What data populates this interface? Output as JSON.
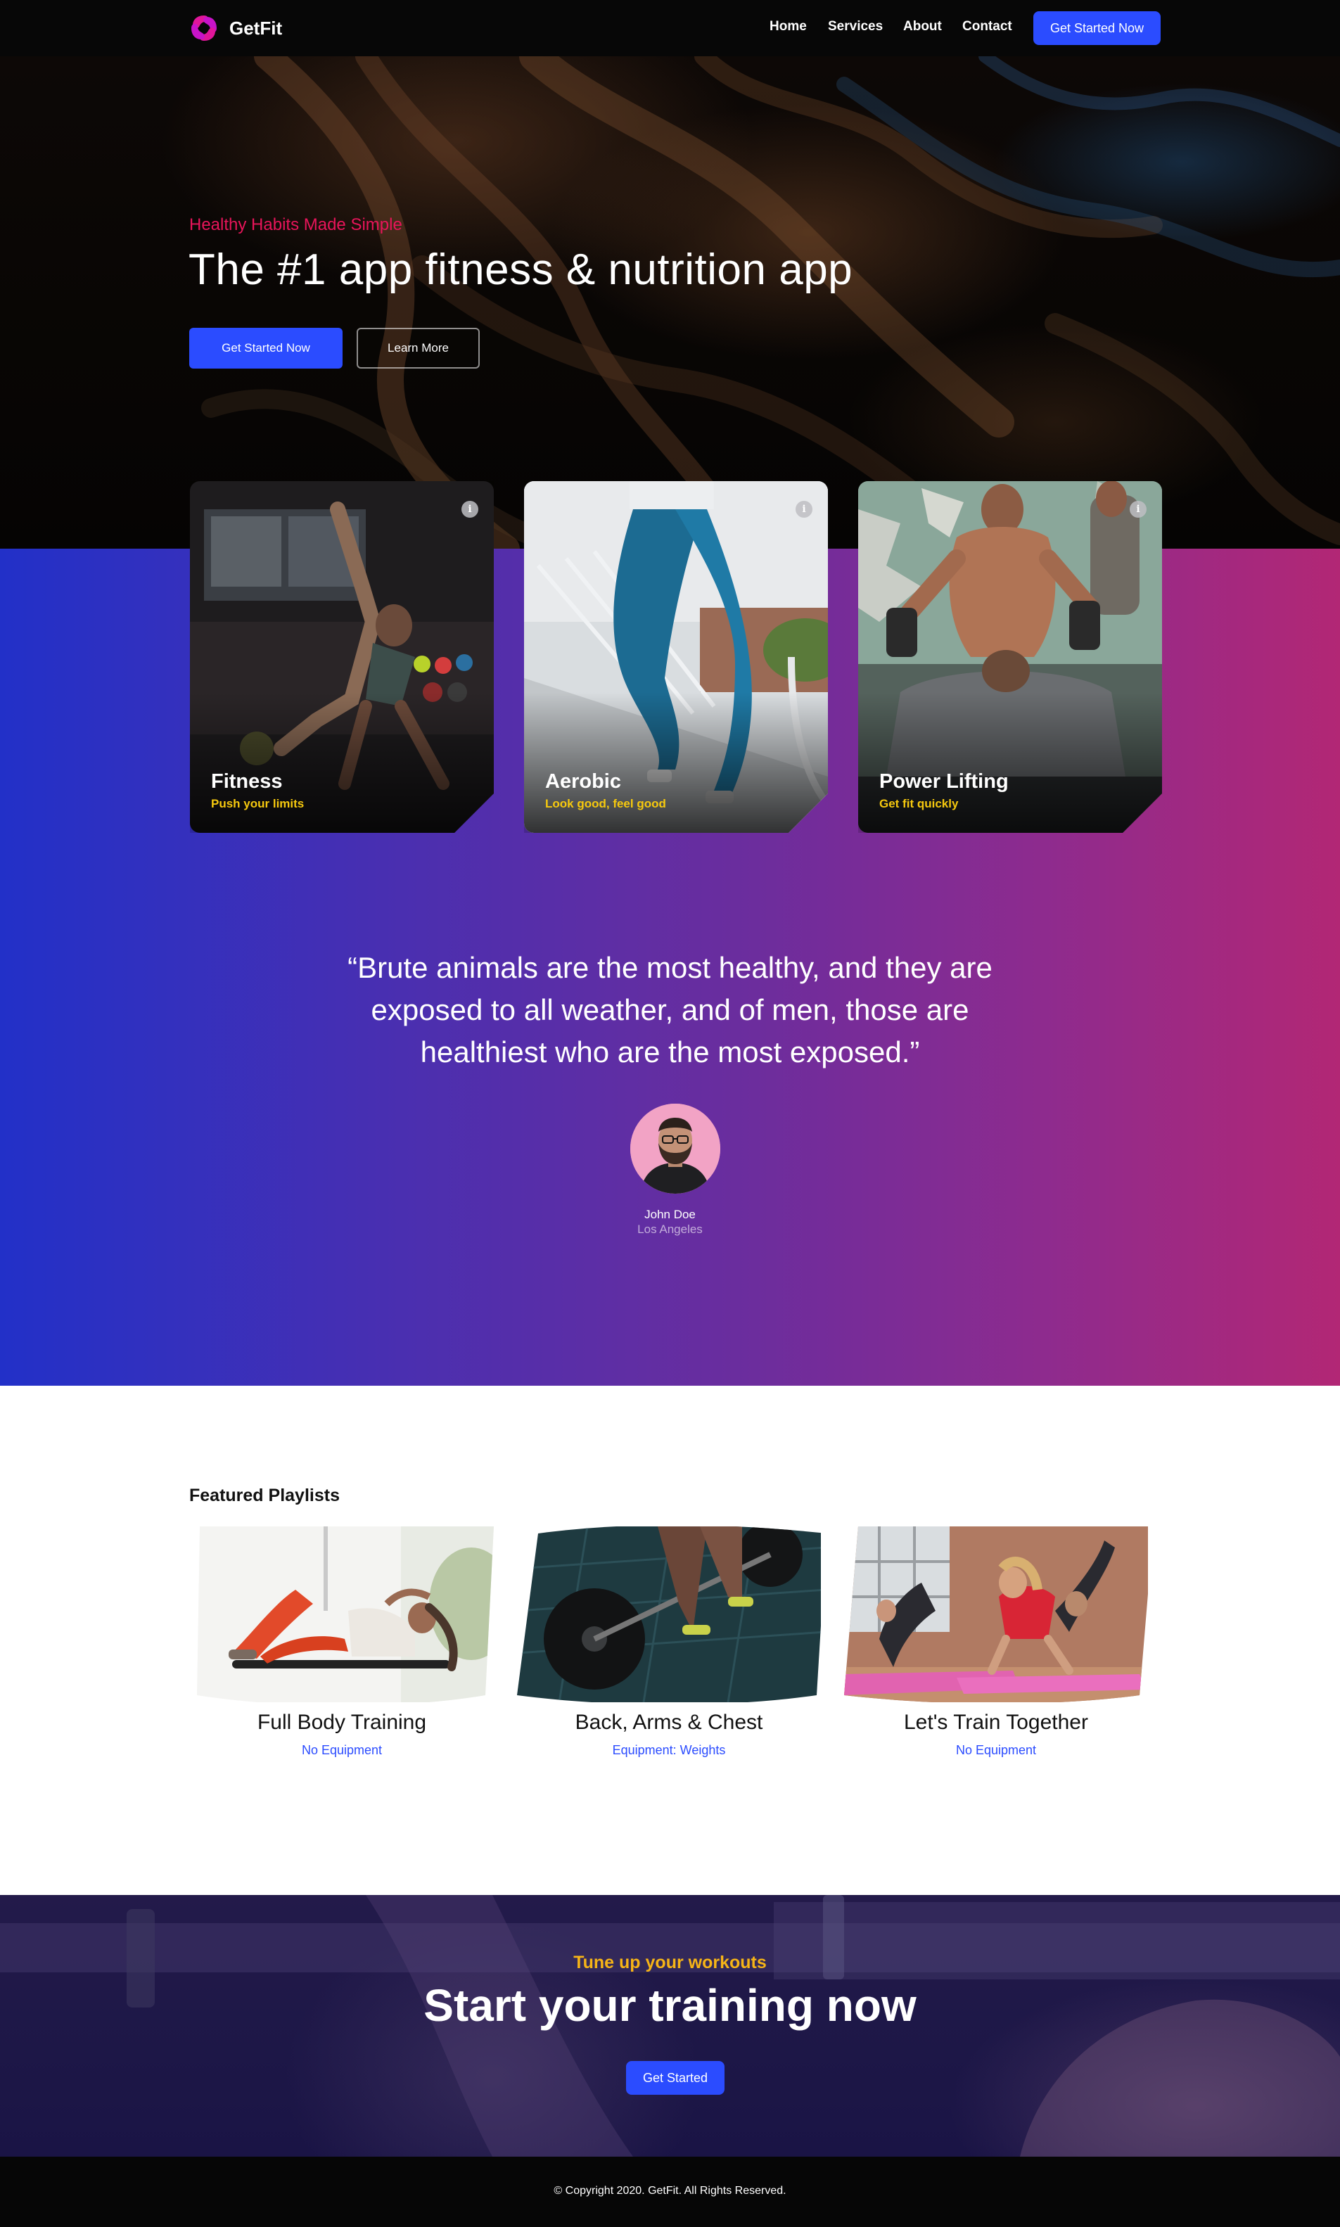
{
  "nav": {
    "brand": "GetFit",
    "links": [
      "Home",
      "Services",
      "About",
      "Contact"
    ],
    "cta_label": "Get Started Now"
  },
  "hero": {
    "eyebrow": "Healthy Habits Made Simple",
    "title": "The #1 app fitness & nutrition app",
    "primary_label": "Get Started Now",
    "secondary_label": "Learn More"
  },
  "cards": [
    {
      "title": "Fitness",
      "subtitle": "Push your limits",
      "info_glyph": "i"
    },
    {
      "title": "Aerobic",
      "subtitle": "Look good, feel good",
      "info_glyph": "i"
    },
    {
      "title": "Power Lifting",
      "subtitle": "Get fit quickly",
      "info_glyph": "i"
    }
  ],
  "testimonial": {
    "quote": "“Brute animals are the most healthy, and they are exposed to all weather, and of men, those are healthiest who are the most exposed.”",
    "name": "John Doe",
    "location": "Los Angeles"
  },
  "playlists": {
    "heading": "Featured Playlists",
    "items": [
      {
        "title": "Full Body Training",
        "subtitle": "No Equipment"
      },
      {
        "title": "Back, Arms & Chest",
        "subtitle": "Equipment: Weights"
      },
      {
        "title": "Let's Train Together",
        "subtitle": "No Equipment"
      }
    ]
  },
  "cta": {
    "eyebrow": "Tune up your workouts",
    "title": "Start your training now",
    "button_label": "Get Started"
  },
  "footer": {
    "copyright": "© Copyright 2020. GetFit. All Rights Reserved."
  },
  "colors": {
    "accent_blue": "#2b4cff",
    "eyebrow_pink": "#e8155a",
    "card_subtitle_yellow": "#f6c90e",
    "cta_eyebrow_yellow": "#f6b417",
    "gradient_left": "#2230c8",
    "gradient_right": "#b22775"
  },
  "icons": {
    "brand_logo": "getfit-logo-icon",
    "card_info": "info-icon"
  }
}
